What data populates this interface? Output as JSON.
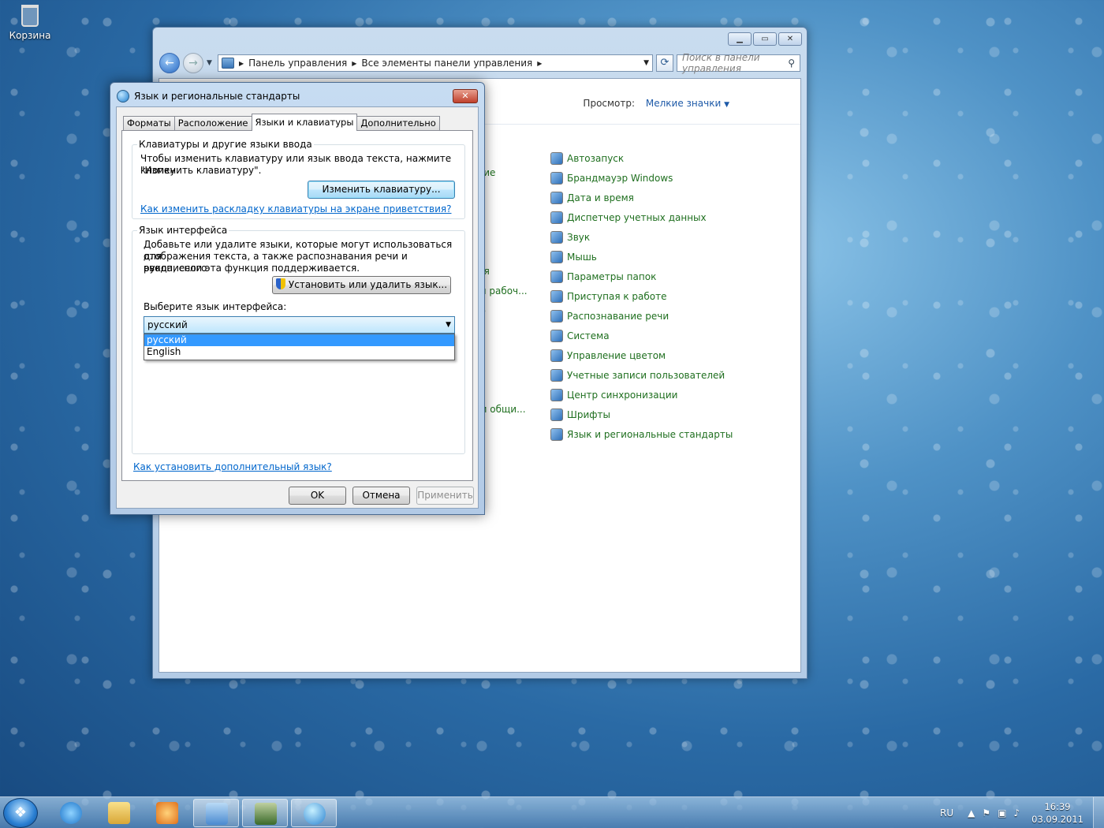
{
  "desktop": {
    "recycle_bin_label": "Корзина"
  },
  "control_panel": {
    "address": {
      "crumb_1": "Панель управления",
      "crumb_2": "Все элементы панели управления"
    },
    "search_placeholder": "Поиск в панели управления",
    "view_label": "Просмотр:",
    "view_value": "Мелкие значки",
    "left_column_fragments": [
      "ение",
      "ния",
      "ым рабоч...",
      "ию",
      "и и общи..."
    ],
    "items": [
      {
        "label": "Автозапуск",
        "icon": "autoplay-icon"
      },
      {
        "label": "Брандмауэр Windows",
        "icon": "firewall-icon"
      },
      {
        "label": "Дата и время",
        "icon": "clock-icon"
      },
      {
        "label": "Диспетчер учетных данных",
        "icon": "credential-manager-icon"
      },
      {
        "label": "Звук",
        "icon": "speaker-icon"
      },
      {
        "label": "Мышь",
        "icon": "mouse-icon"
      },
      {
        "label": "Параметры папок",
        "icon": "folder-options-icon"
      },
      {
        "label": "Приступая к работе",
        "icon": "getting-started-icon"
      },
      {
        "label": "Распознавание речи",
        "icon": "microphone-icon"
      },
      {
        "label": "Система",
        "icon": "system-icon"
      },
      {
        "label": "Управление цветом",
        "icon": "color-management-icon"
      },
      {
        "label": "Учетные записи пользователей",
        "icon": "users-icon"
      },
      {
        "label": "Центр синхронизации",
        "icon": "sync-icon"
      },
      {
        "label": "Шрифты",
        "icon": "fonts-icon"
      },
      {
        "label": "Язык и региональные стандарты",
        "icon": "globe-icon"
      }
    ]
  },
  "dialog": {
    "title": "Язык и региональные стандарты",
    "tabs": [
      "Форматы",
      "Расположение",
      "Языки и клавиатуры",
      "Дополнительно"
    ],
    "active_tab": "Языки и клавиатуры",
    "keyboards_group": {
      "title": "Клавиатуры и другие языки ввода",
      "text_line_1": "Чтобы изменить клавиатуру или язык ввода текста, нажмите кнопку",
      "text_line_2": "\"Изменить клавиатуру\".",
      "button": "Изменить клавиатуру...",
      "link": "Как изменить раскладку клавиатуры на экране приветствия?"
    },
    "display_language_group": {
      "title": "Язык интерфейса",
      "text_line_1": "Добавьте или удалите языки, которые могут использоваться для",
      "text_line_2": "отображения текста, а также распознавания речи и рукописного",
      "text_line_3": "ввода, если эта функция поддерживается.",
      "install_button": "Установить или удалить язык...",
      "choose_label": "Выберите язык интерфейса:",
      "selected": "русский",
      "options": [
        "русский",
        "English"
      ]
    },
    "bottom_link": "Как установить дополнительный язык?",
    "ok": "OK",
    "cancel": "Отмена",
    "apply": "Применить"
  },
  "taskbar": {
    "pinned": [
      "start-icon",
      "internet-explorer-icon",
      "explorer-icon",
      "media-player-icon",
      "control-panel-icon",
      "monitor-icon",
      "region-globe-icon"
    ],
    "language": "RU",
    "time": "16:39",
    "date": "03.09.2011"
  }
}
